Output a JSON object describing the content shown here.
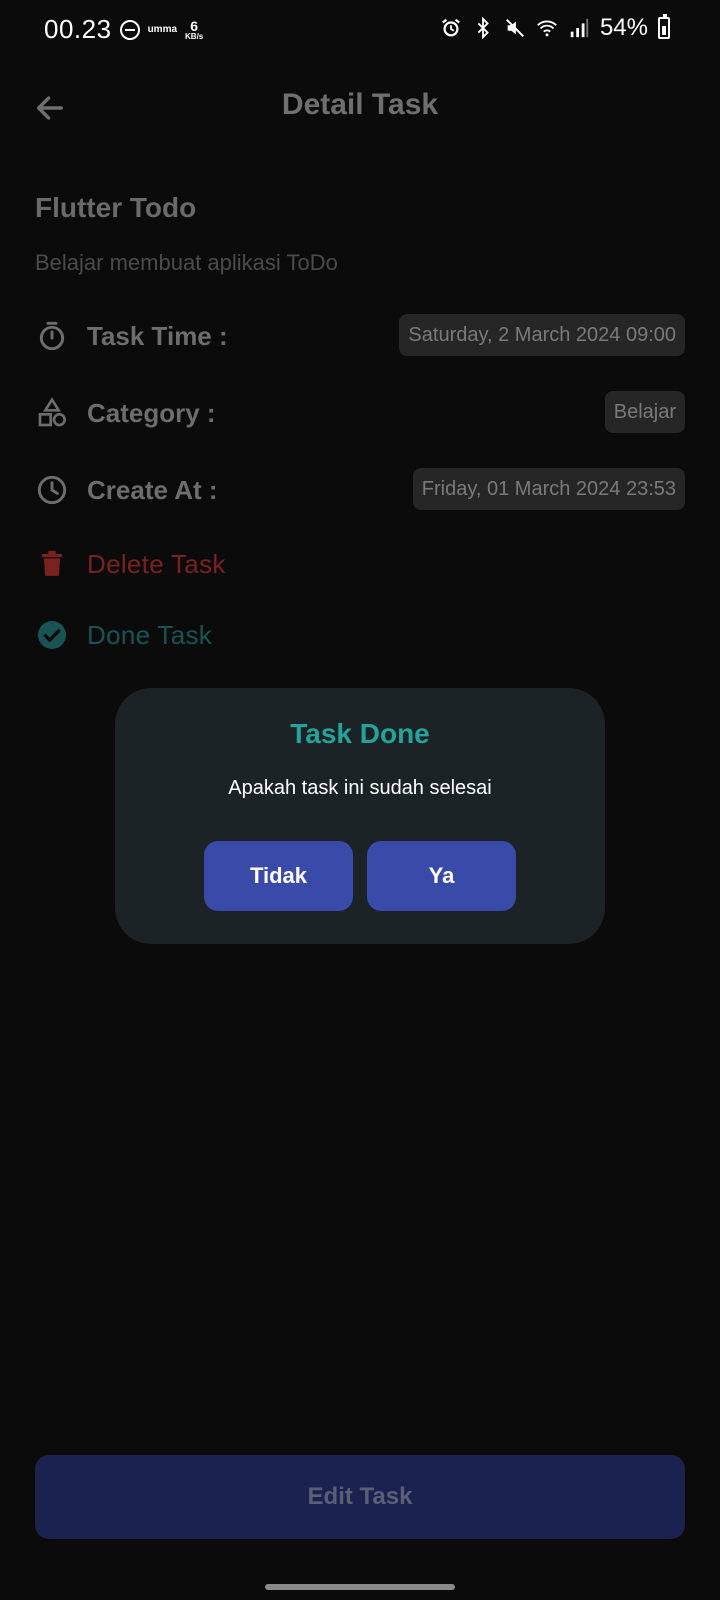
{
  "status_bar": {
    "time": "00.23",
    "carrier": "umma",
    "net_speed": "6",
    "net_unit": "KB/s",
    "battery": "54%"
  },
  "app_bar": {
    "title": "Detail Task"
  },
  "task": {
    "title": "Flutter Todo",
    "description": "Belajar membuat aplikasi ToDo",
    "task_time_label": "Task Time :",
    "task_time_value": "Saturday, 2 March 2024 09:00",
    "category_label": "Category :",
    "category_value": "Belajar",
    "create_at_label": "Create At :",
    "create_at_value": "Friday, 01 March 2024 23:53"
  },
  "actions": {
    "delete_label": "Delete Task",
    "done_label": "Done Task",
    "edit_label": "Edit Task"
  },
  "dialog": {
    "title": "Task Done",
    "message": "Apakah task ini sudah selesai",
    "cancel_label": "Tidak",
    "confirm_label": "Ya"
  },
  "colors": {
    "background": "#0b0b0b",
    "accent_teal": "#25a29a",
    "button_blue": "#3a4aa8",
    "delete_red": "#7a2121"
  }
}
